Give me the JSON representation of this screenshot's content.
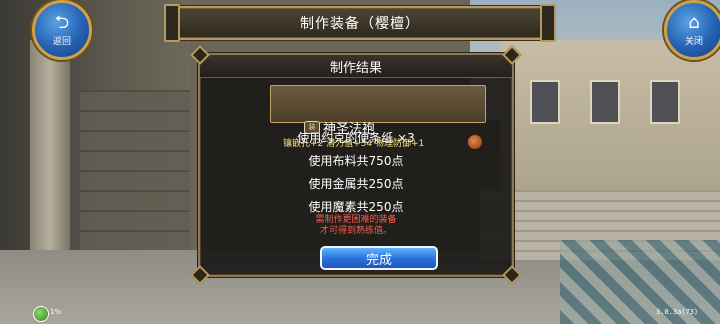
{
  "header": {
    "title": "制作装备（樱檀）",
    "back_label": "返回",
    "close_label": "关闭"
  },
  "dialog": {
    "title": "制作结果",
    "item": {
      "type_icon": "装",
      "name": "神圣法袍",
      "stats": "镶嵌孔+2  潜力值+34  物理防御+1"
    },
    "lines": [
      "使用约克的便条纸  ×3",
      "使用布料共750点",
      "使用金属共250点",
      "使用魔素共250点"
    ],
    "note_line1": "需制作更困难的装备",
    "note_line2": "才可得到熟练值。",
    "done_label": "完成"
  },
  "footer": {
    "status": "1%",
    "version": "3.0.3a(73)"
  },
  "colors": {
    "accent_blue": "#2a6fd8",
    "gold_border": "#b59a5c",
    "stat_yellow": "#f2e27a",
    "note_red": "#ff5a48"
  }
}
